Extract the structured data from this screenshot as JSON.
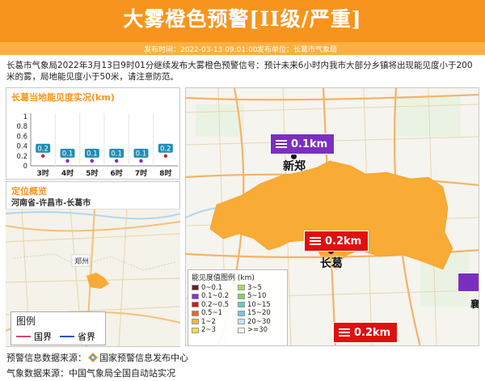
{
  "header": {
    "title": "大雾橙色预警[II级/严重]",
    "publish_time_label": "发布时间：",
    "publish_time": "2022-03-13 09:01:00",
    "publisher_label": "发布单位：",
    "publisher": "长葛市气象局"
  },
  "description": "长葛市气象局2022年3月13日9时01分继续发布大雾橙色预警信号：预计未来6小时内我市大部分乡镇将出现能见度小于200米的雾，局地能见度小于50米，请注意防范。",
  "visibility_panel": {
    "title": "长葛当地能见度实况(km)"
  },
  "chart_data": {
    "type": "scatter",
    "title": "长葛当地能见度实况(km)",
    "categories": [
      "3时",
      "4时",
      "5时",
      "6时",
      "7时",
      "8时"
    ],
    "values": [
      0.2,
      0.1,
      0.1,
      0.1,
      0.1,
      0.2
    ],
    "labels": [
      "0.2",
      "0.1",
      "0.1",
      "0.1",
      "0.1",
      "0.2"
    ],
    "yticks": [
      "0",
      "0.2",
      "0.4",
      "0.6",
      "0.8",
      "1"
    ],
    "ylim": [
      0,
      1
    ],
    "grid": false,
    "colors": {
      "label_bg": "#1f8fb4",
      "point_0_2": "#c1272d",
      "point_0_1": "#7b2fbf"
    }
  },
  "location_panel": {
    "title": "定位概览",
    "region": "河南省-许昌市-长葛市",
    "legend_title": "图例",
    "legend_items": [
      {
        "label": "国界",
        "color": "#d24b6a"
      },
      {
        "label": "省界",
        "color": "#2a55c8"
      }
    ],
    "labels": [
      "郑州"
    ]
  },
  "main_map": {
    "cities": [
      "新郑",
      "长葛"
    ],
    "tags": [
      {
        "text": "0.1km",
        "color": "#7b2fbf"
      },
      {
        "text": "0.2km",
        "color": "#e01010"
      },
      {
        "text": "0.2km",
        "color": "#e01010"
      }
    ],
    "edge_label": "襄",
    "legend_title": "能见度值图例 (km)",
    "legend_items": [
      {
        "label": "0~0.1",
        "color": "#6b1e1e"
      },
      {
        "label": "3~5",
        "color": "#a3e04a"
      },
      {
        "label": "0.1~0.2",
        "color": "#8a2be2"
      },
      {
        "label": "5~10",
        "color": "#7ed957"
      },
      {
        "label": "0.2~0.5",
        "color": "#e01010"
      },
      {
        "label": "10~15",
        "color": "#5ad1b3"
      },
      {
        "label": "0.5~1",
        "color": "#f26522"
      },
      {
        "label": "15~20",
        "color": "#6ec6f0"
      },
      {
        "label": "1~2",
        "color": "#f7b731"
      },
      {
        "label": "20~30",
        "color": "#bfe6f7"
      },
      {
        "label": "2~3",
        "color": "#f3e03b"
      },
      {
        "label": ">=30",
        "color": "#ffffff"
      }
    ],
    "fog_color": "#f8ab35"
  },
  "footer": {
    "warning_source_label": "预警信息数据来源：",
    "warning_source": "国家预警信息发布中心",
    "weather_source_label": "气象数据来源：",
    "weather_source": "中国气象局全国自动站实况"
  }
}
